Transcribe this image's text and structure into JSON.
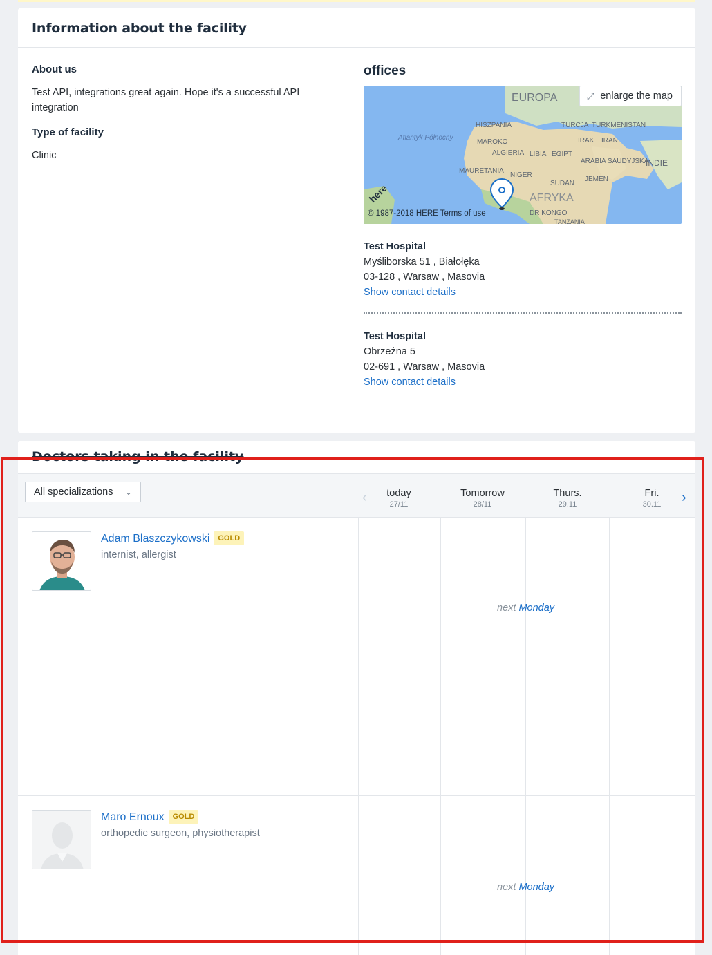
{
  "facility": {
    "title": "Information about the facility",
    "about_heading": "About us",
    "about_text": "Test API, integrations great again. Hope it's a successful API integration",
    "type_heading": "Type of facility",
    "type_value": "Clinic"
  },
  "offices": {
    "heading": "offices",
    "enlarge_label": "enlarge the map",
    "map_copyright": "© 1987-2018 HERE Terms of use",
    "map_brand": "here",
    "map_labels": [
      "EUROPA",
      "Atlantyk Północny",
      "HISZPANIA",
      "TURCJA",
      "TURKMENISTAN",
      "MAROKO",
      "IRAK",
      "IRAN",
      "ALGIERIA",
      "LIBIA",
      "EGIPT",
      "ARABIA SAUDYJSKA",
      "INDIE",
      "MAURETANIA",
      "NIGER",
      "JEMEN",
      "SUDAN",
      "AFRYKA",
      "DR KONGO",
      "TANZANIA"
    ],
    "list": [
      {
        "name": "Test Hospital",
        "line1": "Myśliborska 51 , Białołęka",
        "line2": "03-128 , Warsaw , Masovia",
        "link": "Show contact details"
      },
      {
        "name": "Test Hospital",
        "line1": "Obrzeżna 5",
        "line2": "02-691 , Warsaw , Masovia",
        "link": "Show contact details"
      }
    ]
  },
  "doctors": {
    "title": "Doctors taking in the facility",
    "filter_label": "All specializations",
    "days": [
      {
        "label": "today",
        "date": "27/11"
      },
      {
        "label": "Tomorrow",
        "date": "28/11"
      },
      {
        "label": "Thurs.",
        "date": "29.11"
      },
      {
        "label": "Fri.",
        "date": "30.11"
      }
    ],
    "list": [
      {
        "name": "Adam Blaszczykowski",
        "badge": "GOLD",
        "specialties": "internist, allergist",
        "next_word": "next",
        "next_day": "Monday"
      },
      {
        "name": "Maro Ernoux",
        "badge": "GOLD",
        "specialties": "orthopedic surgeon, physiotherapist",
        "next_word": "next",
        "next_day": "Monday"
      }
    ]
  }
}
